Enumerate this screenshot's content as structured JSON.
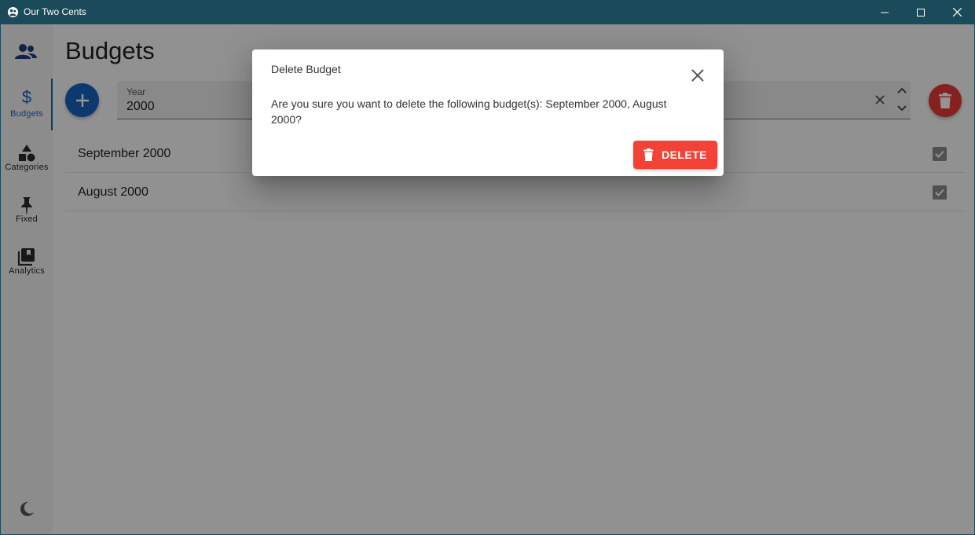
{
  "window": {
    "title": "Our Two Cents"
  },
  "sidebar": {
    "items": [
      {
        "label": "Budgets",
        "icon": "dollar-icon",
        "active": true
      },
      {
        "label": "Categories",
        "icon": "shapes-icon",
        "active": false
      },
      {
        "label": "Fixed",
        "icon": "pin-icon",
        "active": false
      },
      {
        "label": "Analytics",
        "icon": "library-icon",
        "active": false
      }
    ],
    "top_icon": "people-icon",
    "bottom_icon": "moon-icon"
  },
  "main": {
    "page_title": "Budgets",
    "year_field": {
      "label": "Year",
      "value": "2000"
    },
    "budgets": [
      {
        "name": "September 2000",
        "checked": true
      },
      {
        "name": "August 2000",
        "checked": true
      }
    ]
  },
  "dialog": {
    "title": "Delete Budget",
    "message": "Are you sure you want to delete the following budget(s): September 2000, August 2000?",
    "delete_label": "DELETE"
  },
  "colors": {
    "titlebar": "#1b4a5a",
    "primary": "#1565c0",
    "danger": "#f44336"
  }
}
